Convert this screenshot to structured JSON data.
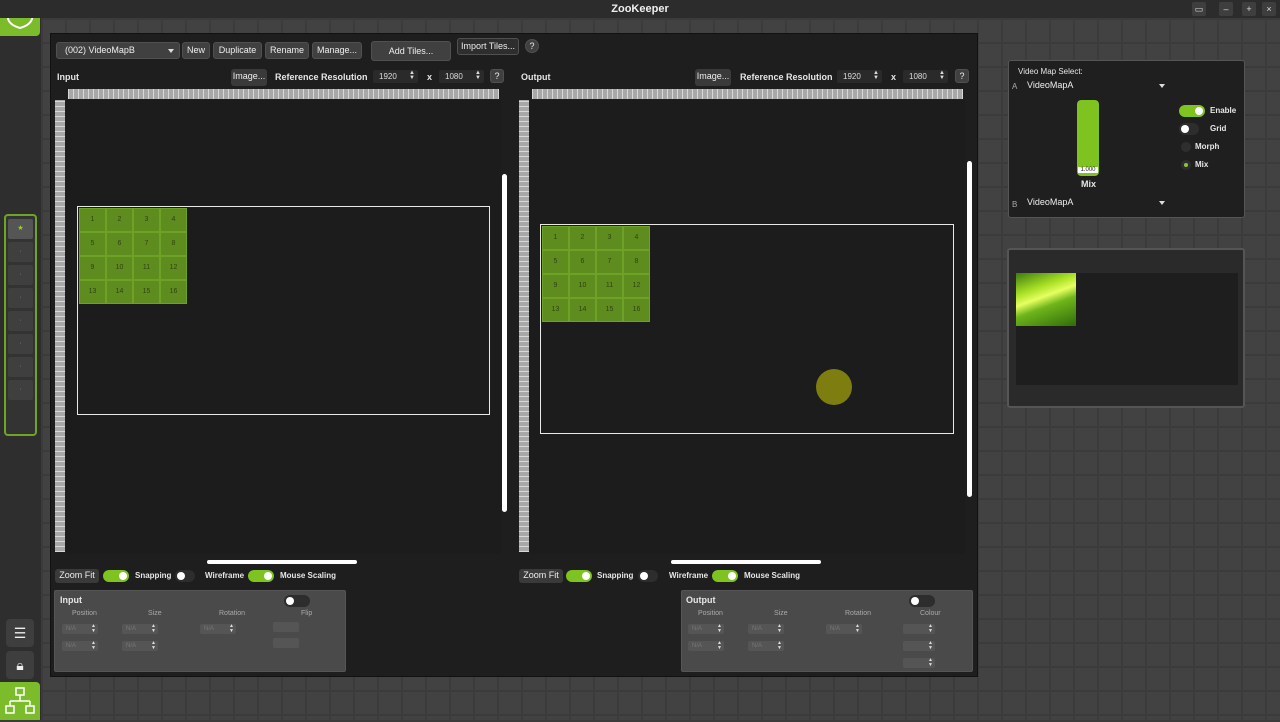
{
  "app": {
    "title": "ZooKeeper"
  },
  "toolbar": {
    "map_select": "(002) VideoMapB",
    "new": "New",
    "duplicate": "Duplicate",
    "rename": "Rename",
    "manage": "Manage...",
    "add_tiles": "Add Tiles...",
    "import_tiles": "Import Tiles...",
    "help": "?"
  },
  "input_view": {
    "label": "Input",
    "image_btn": "Image...",
    "ref_res_label": "Reference Resolution",
    "width": "1920",
    "x": "x",
    "height": "1080",
    "help": "?",
    "tiles": [
      "1",
      "2",
      "3",
      "4",
      "5",
      "6",
      "7",
      "8",
      "9",
      "10",
      "11",
      "12",
      "13",
      "14",
      "15",
      "16"
    ]
  },
  "output_view": {
    "label": "Output",
    "image_btn": "Image...",
    "ref_res_label": "Reference Resolution",
    "width": "1920",
    "x": "x",
    "height": "1080",
    "help": "?",
    "tiles": [
      "1",
      "2",
      "3",
      "4",
      "5",
      "6",
      "7",
      "8",
      "9",
      "10",
      "11",
      "12",
      "13",
      "14",
      "15",
      "16"
    ]
  },
  "input_options": {
    "zoom_fit": "Zoom Fit",
    "snapping": "Snapping",
    "wireframe": "Wireframe",
    "mouse_scaling": "Mouse Scaling"
  },
  "output_options": {
    "zoom_fit": "Zoom Fit",
    "snapping": "Snapping",
    "wireframe": "Wireframe",
    "mouse_scaling": "Mouse Scaling"
  },
  "input_panel": {
    "title": "Input",
    "position": "Position",
    "size": "Size",
    "rotation": "Rotation",
    "flip": "Flip",
    "placeholder": "N/A"
  },
  "output_panel": {
    "title": "Output",
    "position": "Position",
    "size": "Size",
    "rotation": "Rotation",
    "colour": "Colour",
    "placeholder": "N/A"
  },
  "video_map_select": {
    "title": "Video Map Select:",
    "a_label": "A",
    "a_value": "VideoMapA",
    "b_label": "B",
    "b_value": "VideoMapA",
    "mix_value": "1.000",
    "mix_label": "Mix",
    "mix_level": 1.0,
    "enable": "Enable",
    "grid": "Grid",
    "morph": "Morph",
    "mix": "Mix"
  },
  "colors": {
    "accent": "#7ec31f",
    "tile": "#5f8c1f"
  },
  "icons": {
    "logo": "zookeeper-logo-icon",
    "lock": "lock-icon",
    "list": "list-icon"
  }
}
